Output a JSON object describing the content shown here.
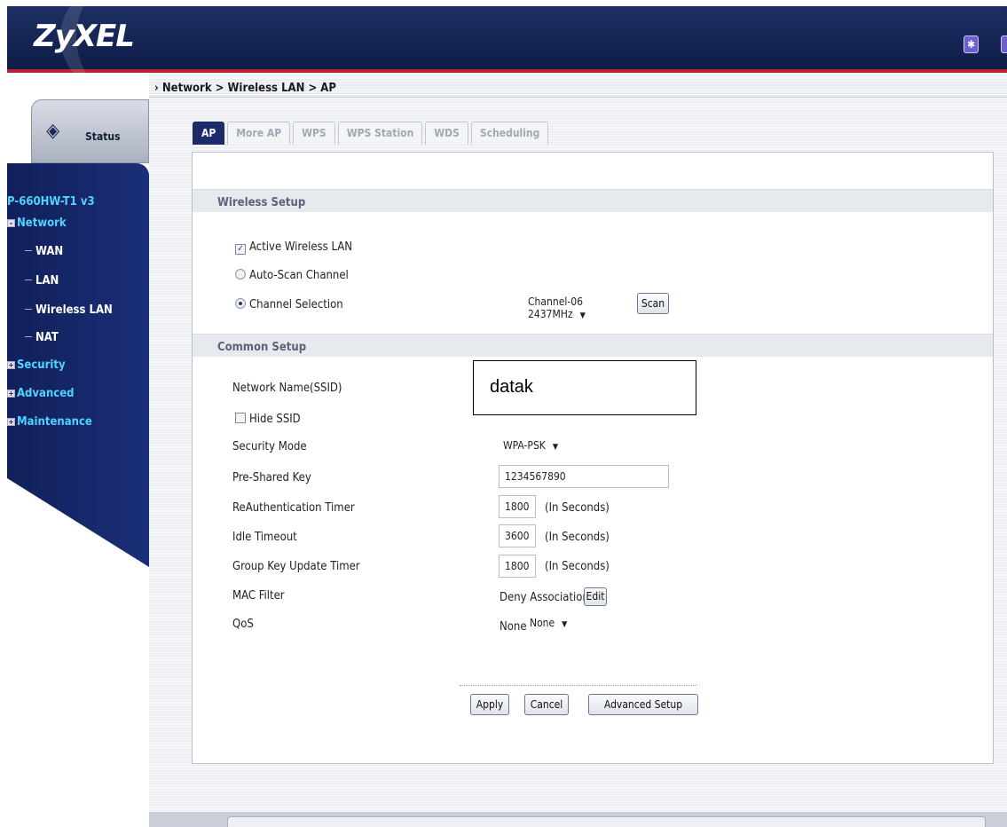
{
  "header": {
    "logo": "ZyXEL"
  },
  "breadcrumb": "Network > Wireless LAN > AP",
  "sidebar": {
    "status_label": "Status",
    "model": "P-660HW-T1 v3",
    "items": [
      {
        "label": "Network"
      },
      {
        "label": "WAN"
      },
      {
        "label": "LAN"
      },
      {
        "label": "Wireless LAN"
      },
      {
        "label": "NAT"
      },
      {
        "label": "Security"
      },
      {
        "label": "Advanced"
      },
      {
        "label": "Maintenance"
      }
    ]
  },
  "tabs": [
    "AP",
    "More AP",
    "WPS",
    "WPS Station",
    "WDS",
    "Scheduling"
  ],
  "wireless_setup": {
    "title": "Wireless Setup",
    "active_wireless_lan": "Active Wireless LAN",
    "auto_scan": "Auto-Scan Channel",
    "channel_selection": "Channel Selection",
    "channel_value": "Channel-06 2437MHz",
    "scan_button": "Scan"
  },
  "common_setup": {
    "title": "Common Setup",
    "ssid_label": "Network Name(SSID)",
    "ssid_value": "datak",
    "hide_ssid": "Hide SSID",
    "security_mode_label": "Security Mode",
    "security_mode_value": "WPA-PSK",
    "psk_label": "Pre-Shared Key",
    "psk_value": "1234567890",
    "reauth_label": "ReAuthentication Timer",
    "reauth_value": "1800",
    "idle_label": "Idle Timeout",
    "idle_value": "3600",
    "group_key_label": "Group Key Update Timer",
    "group_key_value": "1800",
    "unit": "(In Seconds)",
    "mac_label": "MAC Filter",
    "mac_value": "Deny Association",
    "edit_button": "Edit",
    "qos_label": "QoS",
    "qos_value": "None",
    "qos_select": "None"
  },
  "actions": {
    "apply": "Apply",
    "cancel": "Cancel",
    "advanced": "Advanced Setup"
  }
}
